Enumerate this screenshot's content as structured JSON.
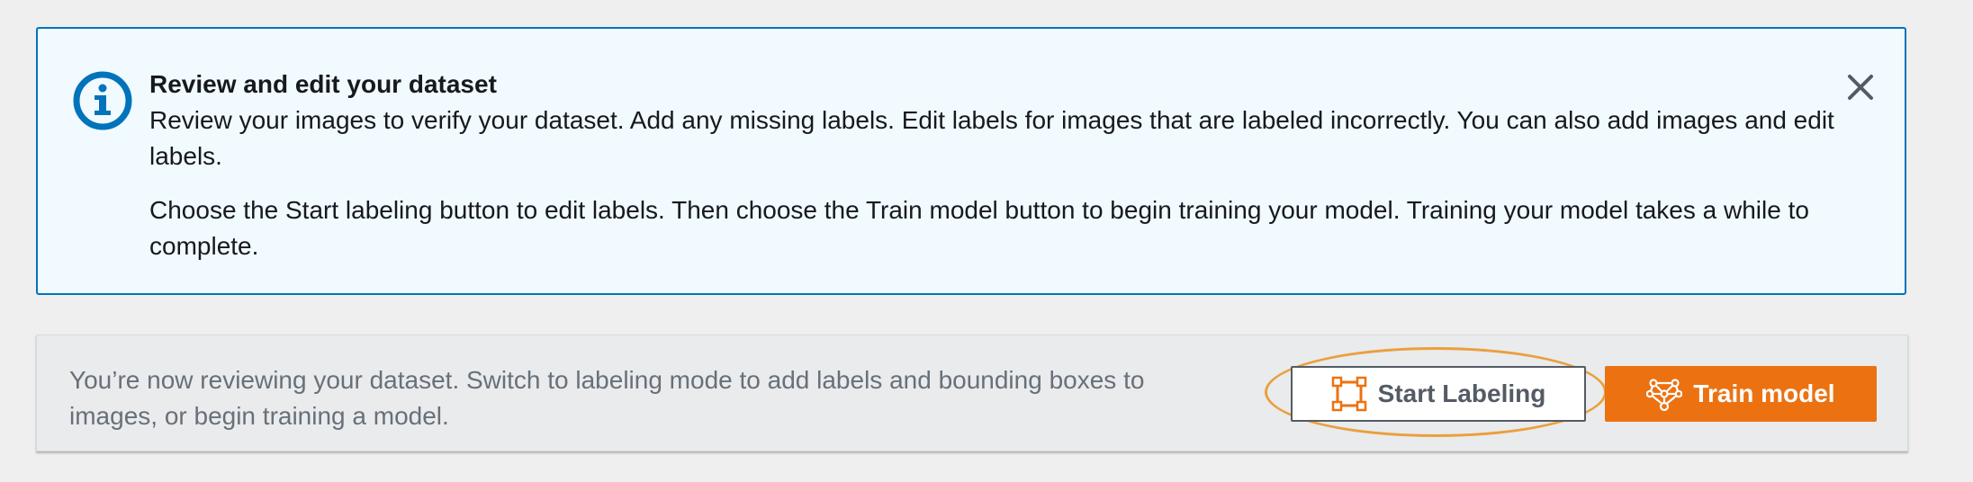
{
  "alert": {
    "icon": "info-icon",
    "title": "Review and edit your dataset",
    "paragraph1": "Review your images to verify your dataset. Add any missing labels. Edit labels for images that are labeled incorrectly. You can also add images and edit labels.",
    "paragraph2": "Choose the Start labeling button to edit labels. Then choose the Train model button to begin training your model. Training your model takes a while to complete.",
    "close_icon": "close-icon"
  },
  "action_bar": {
    "description": "You’re now reviewing your dataset. Switch to labeling mode to add labels and bounding boxes to images, or begin training a model.",
    "start_labeling_label": "Start Labeling",
    "start_labeling_icon": "bounding-box-icon",
    "train_model_label": "Train model",
    "train_model_icon": "neural-network-icon"
  },
  "colors": {
    "info_blue": "#0073bb",
    "alert_bg": "#f1faff",
    "primary_orange": "#ec7211",
    "highlight_orange": "#eb9f3c"
  }
}
